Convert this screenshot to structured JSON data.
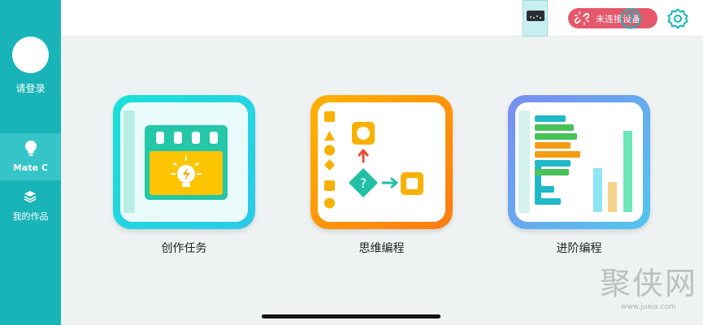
{
  "sidebar": {
    "login_label": "请登录",
    "items": [
      {
        "label": "Mate C",
        "icon": "lightbulb-icon",
        "active": true
      },
      {
        "label": "我的作品",
        "icon": "layers-icon",
        "active": false
      }
    ]
  },
  "topbar": {
    "device_icon": "device-screen-icon",
    "status_label": "未连接设备",
    "status_icon": "unlink-icon",
    "status_color": "#e5576a",
    "help_icon": "help-icon",
    "settings_icon": "settings-gear-icon",
    "accent_color": "#18b4b8"
  },
  "cards": [
    {
      "label": "创作任务",
      "theme": "cyan"
    },
    {
      "label": "思维编程",
      "theme": "orange"
    },
    {
      "label": "进阶编程",
      "theme": "blue"
    }
  ],
  "watermark": {
    "text": "聚侠网",
    "url": "www.juxia.com"
  }
}
